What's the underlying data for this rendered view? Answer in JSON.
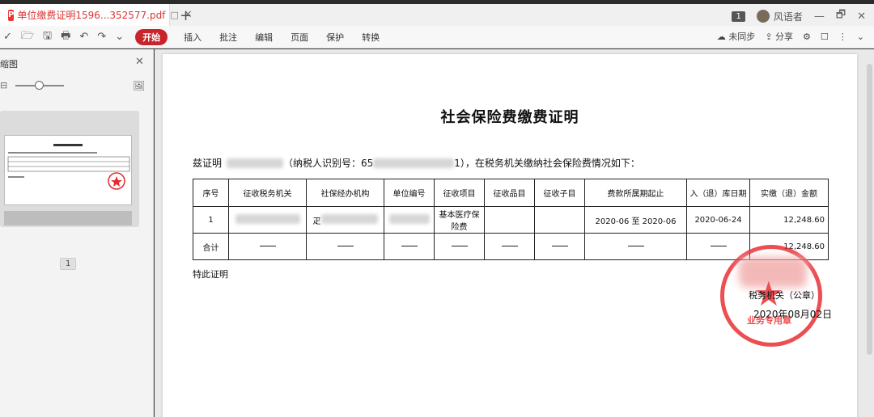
{
  "tab": {
    "badge": "P",
    "title": "单位缴费证明1596...352577.pdf",
    "icon": "□",
    "close": "✕"
  },
  "titlebar": {
    "add": "+",
    "page_badge": "1",
    "user": "风语者",
    "minimize": "—",
    "restore": "🗗",
    "close": "✕"
  },
  "toolbar": {
    "icons": [
      "✓",
      "🗁",
      "🖫",
      "🖶",
      "↶",
      "↷",
      "⌄"
    ],
    "start_label": "开始",
    "menu": [
      "插入",
      "批注",
      "编辑",
      "页面",
      "保护",
      "转换"
    ],
    "sync_label": "未同步",
    "share_label": "分享"
  },
  "leftpanel": {
    "title": "缩图",
    "close": "✕",
    "page_number": "1"
  },
  "document": {
    "title": "社会保险费缴费证明",
    "intro_prefix": "兹证明",
    "intro_mid": "（纳税人识别号：65",
    "intro_suffix": "1），在税务机关缴纳社会保险费情况如下：",
    "table": {
      "headers": [
        "序号",
        "征收税务机关",
        "社保经办机构",
        "单位编号",
        "征收项目",
        "征收品目",
        "征收子目",
        "费款所属期起止",
        "入（退）库日期",
        "实缴（退）金额"
      ],
      "row1": {
        "index": "1",
        "agency_frag": "疋",
        "item": "基本医疗保险费",
        "period": "2020-06 至 2020-06",
        "date": "2020-06-24",
        "amount": "12,248.60"
      },
      "total": {
        "label": "合计",
        "amount": "12,248.60"
      }
    },
    "closing": "特此证明",
    "sign_org": "税务机关（公章）",
    "sign_date": "2020年08月02日",
    "seal_text": "业务专用章"
  }
}
